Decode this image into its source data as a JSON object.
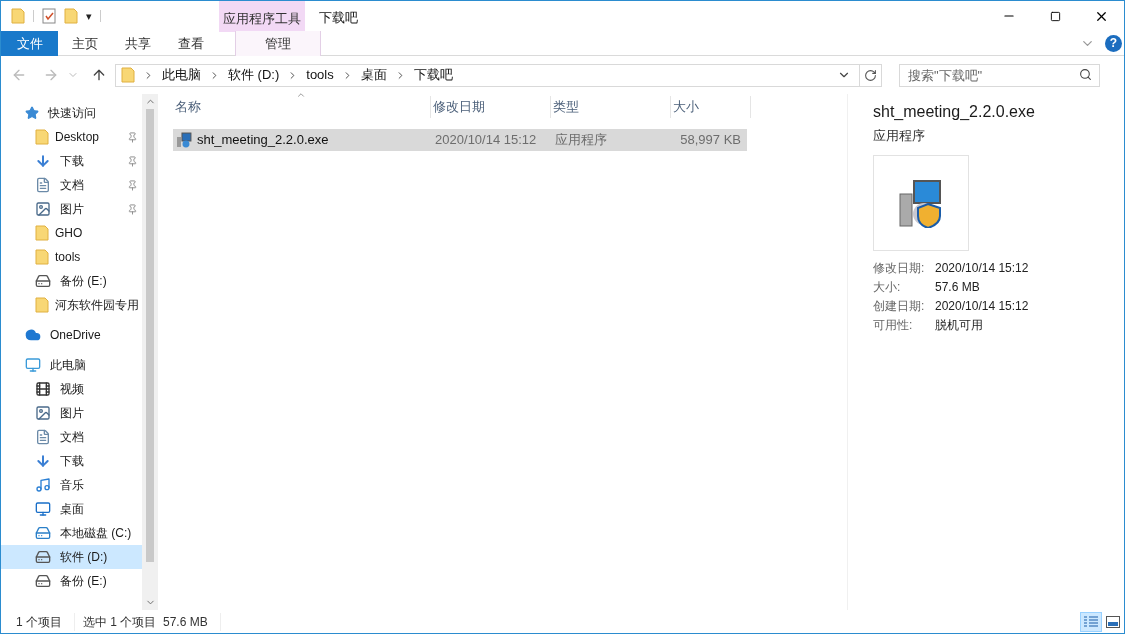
{
  "quick_access_toolbar": {
    "menu_glyph": "▾"
  },
  "context_tab_group": {
    "label": "应用程序工具"
  },
  "window": {
    "title": "下载吧"
  },
  "help_button": {
    "glyph": "?"
  },
  "ribbon_tabs": [
    {
      "label": "文件",
      "kind": "file",
      "selected": false
    },
    {
      "label": "主页",
      "kind": "tab",
      "selected": false
    },
    {
      "label": "共享",
      "kind": "tab",
      "selected": false
    },
    {
      "label": "查看",
      "kind": "tab",
      "selected": false
    },
    {
      "label": "管理",
      "kind": "context",
      "selected": false
    }
  ],
  "address_bar": {
    "path": [
      "此电脑",
      "软件 (D:)",
      "tools",
      "桌面",
      "下载吧"
    ]
  },
  "search": {
    "placeholder": "搜索\"下载吧\""
  },
  "sidebar": {
    "items": [
      {
        "label": "快速访问",
        "kind": "star",
        "selected": false,
        "children": [
          {
            "label": "Desktop",
            "kind": "folder",
            "pinned": true,
            "selected": false
          },
          {
            "label": "下载",
            "kind": "download",
            "pinned": true,
            "selected": false
          },
          {
            "label": "文档",
            "kind": "document",
            "pinned": true,
            "selected": false
          },
          {
            "label": "图片",
            "kind": "picture",
            "pinned": true,
            "selected": false
          },
          {
            "label": "GHO",
            "kind": "folder",
            "pinned": false,
            "selected": false
          },
          {
            "label": "tools",
            "kind": "folder",
            "pinned": false,
            "selected": false
          },
          {
            "label": "备份 (E:)",
            "kind": "drive",
            "pinned": false,
            "selected": false
          },
          {
            "label": "河东软件园专用",
            "kind": "folder",
            "pinned": false,
            "selected": false
          }
        ]
      },
      {
        "label": "OneDrive",
        "kind": "cloud",
        "selected": false
      },
      {
        "label": "此电脑",
        "kind": "pc",
        "selected": false,
        "children": [
          {
            "label": "视频",
            "kind": "video",
            "pinned": false,
            "selected": false
          },
          {
            "label": "图片",
            "kind": "picture",
            "pinned": false,
            "selected": false
          },
          {
            "label": "文档",
            "kind": "document",
            "pinned": false,
            "selected": false
          },
          {
            "label": "下载",
            "kind": "download",
            "pinned": false,
            "selected": false
          },
          {
            "label": "音乐",
            "kind": "music",
            "pinned": false,
            "selected": false
          },
          {
            "label": "桌面",
            "kind": "desktop",
            "pinned": false,
            "selected": false
          },
          {
            "label": "本地磁盘 (C:)",
            "kind": "localdisk",
            "pinned": false,
            "selected": false
          },
          {
            "label": "软件 (D:)",
            "kind": "drive",
            "pinned": false,
            "selected": true
          },
          {
            "label": "备份 (E:)",
            "kind": "drive",
            "pinned": false,
            "selected": false
          }
        ]
      }
    ]
  },
  "table": {
    "columns": [
      "名称",
      "修改日期",
      "类型",
      "大小"
    ],
    "rows": [
      {
        "cells": [
          "sht_meeting_2.2.0.exe",
          "2020/10/14 15:12",
          "应用程序",
          "58,997 KB"
        ],
        "selected": true
      }
    ]
  },
  "details_pane": {
    "title": "sht_meeting_2.2.0.exe",
    "subtitle": "应用程序",
    "properties": [
      {
        "label": "修改日期:",
        "value": "2020/10/14 15:12"
      },
      {
        "label": "大小:",
        "value": "57.6 MB"
      },
      {
        "label": "创建日期:",
        "value": "2020/10/14 15:12"
      },
      {
        "label": "可用性:",
        "value": "脱机可用"
      }
    ]
  },
  "status_bar": {
    "items": [
      "1 个项目",
      "选中 1 个项目  57.6 MB"
    ]
  },
  "view_buttons": [
    {
      "kind": "details",
      "selected": true
    },
    {
      "kind": "large-icons",
      "selected": false
    }
  ]
}
